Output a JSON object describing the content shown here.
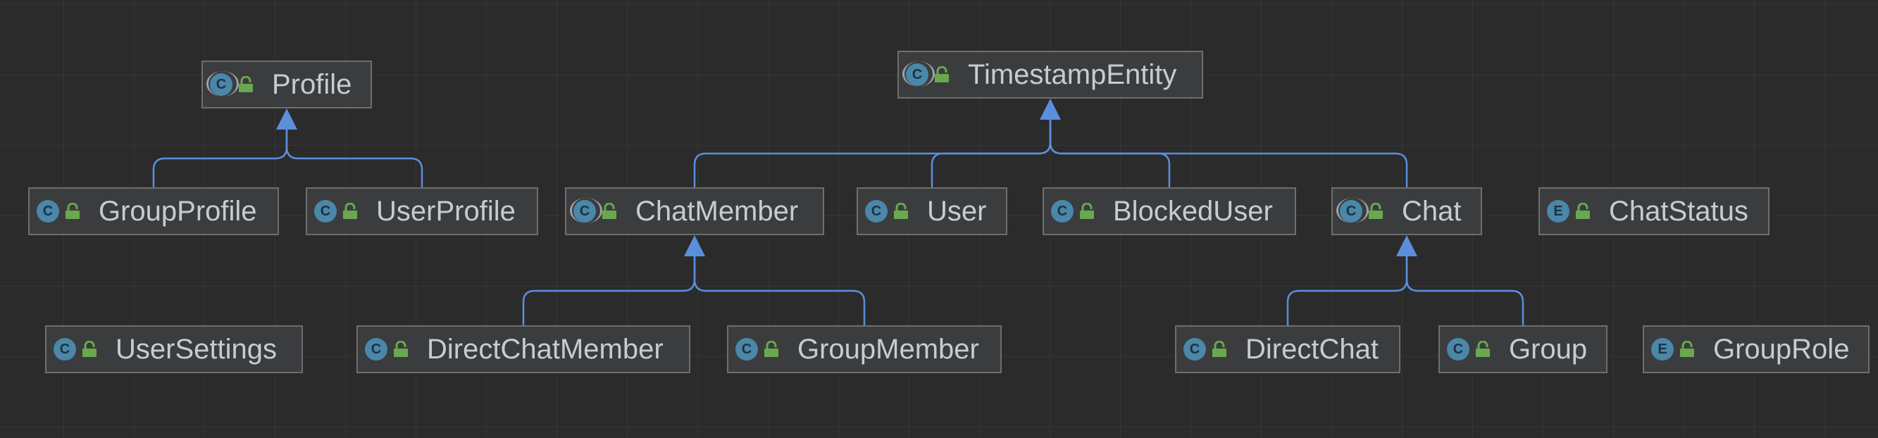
{
  "colors": {
    "background": "#2b2b2b",
    "node_fill": "#3b3c3e",
    "node_border": "#6e6e6e",
    "edge": "#5b8fdc",
    "class_badge": "#4a87a8",
    "visibility_lock": "#6aa84f",
    "text": "#c8cbcf"
  },
  "nodes": {
    "profile": {
      "name": "Profile",
      "kind_letter": "C",
      "kind_icon": "abstract-class-icon"
    },
    "timestamp_entity": {
      "name": "TimestampEntity",
      "kind_letter": "C",
      "kind_icon": "abstract-class-icon"
    },
    "group_profile": {
      "name": "GroupProfile",
      "kind_letter": "C",
      "kind_icon": "class-icon"
    },
    "user_profile": {
      "name": "UserProfile",
      "kind_letter": "C",
      "kind_icon": "class-icon"
    },
    "chat_member": {
      "name": "ChatMember",
      "kind_letter": "C",
      "kind_icon": "abstract-class-icon"
    },
    "user": {
      "name": "User",
      "kind_letter": "C",
      "kind_icon": "class-icon"
    },
    "blocked_user": {
      "name": "BlockedUser",
      "kind_letter": "C",
      "kind_icon": "class-icon"
    },
    "chat": {
      "name": "Chat",
      "kind_letter": "C",
      "kind_icon": "abstract-class-icon"
    },
    "chat_status": {
      "name": "ChatStatus",
      "kind_letter": "E",
      "kind_icon": "enum-icon"
    },
    "user_settings": {
      "name": "UserSettings",
      "kind_letter": "C",
      "kind_icon": "class-icon"
    },
    "direct_chat_member": {
      "name": "DirectChatMember",
      "kind_letter": "C",
      "kind_icon": "class-icon"
    },
    "group_member": {
      "name": "GroupMember",
      "kind_letter": "C",
      "kind_icon": "class-icon"
    },
    "direct_chat": {
      "name": "DirectChat",
      "kind_letter": "C",
      "kind_icon": "class-icon"
    },
    "group": {
      "name": "Group",
      "kind_letter": "C",
      "kind_icon": "class-icon"
    },
    "group_role": {
      "name": "GroupRole",
      "kind_letter": "E",
      "kind_icon": "enum-icon"
    }
  },
  "inheritance": [
    {
      "child": "group_profile",
      "parent": "profile"
    },
    {
      "child": "user_profile",
      "parent": "profile"
    },
    {
      "child": "chat_member",
      "parent": "timestamp_entity"
    },
    {
      "child": "user",
      "parent": "timestamp_entity"
    },
    {
      "child": "blocked_user",
      "parent": "timestamp_entity"
    },
    {
      "child": "chat",
      "parent": "timestamp_entity"
    },
    {
      "child": "direct_chat_member",
      "parent": "chat_member"
    },
    {
      "child": "group_member",
      "parent": "chat_member"
    },
    {
      "child": "direct_chat",
      "parent": "chat"
    },
    {
      "child": "group",
      "parent": "chat"
    }
  ]
}
